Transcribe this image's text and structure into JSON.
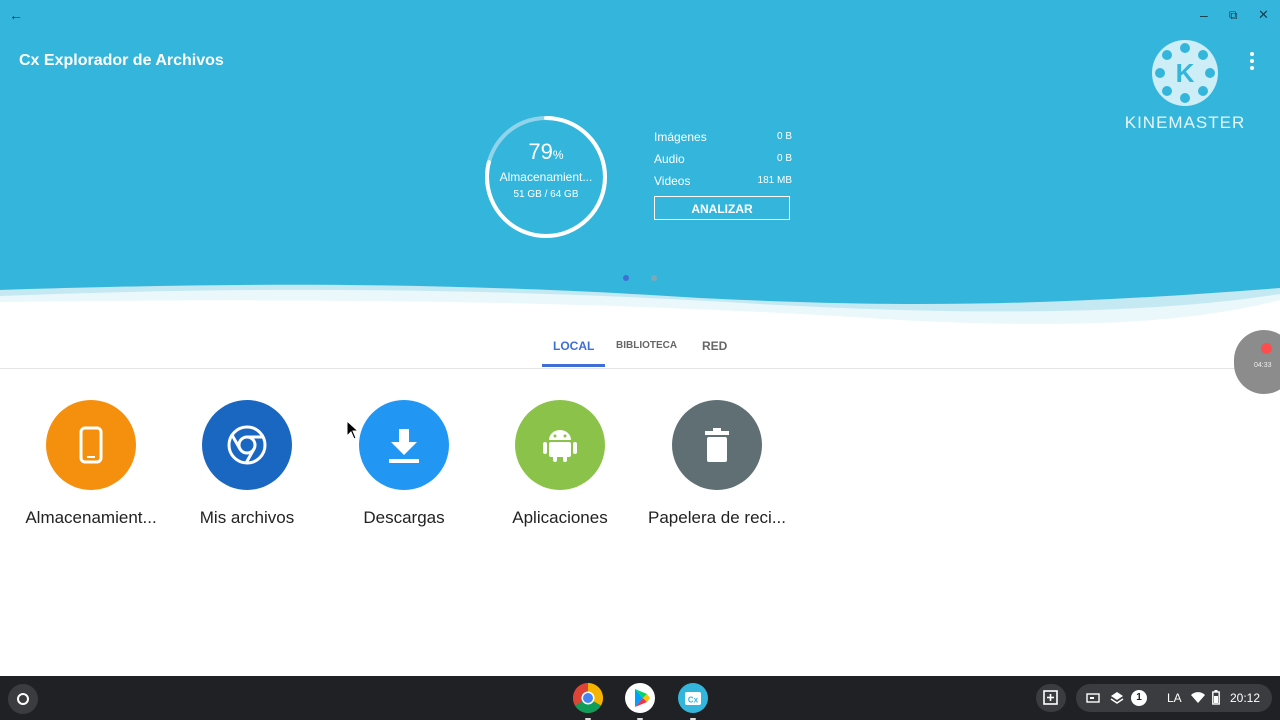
{
  "window": {
    "back_icon": "arrow-left-icon",
    "minimize": "–",
    "restore": "⧉",
    "close": "✕"
  },
  "app": {
    "title": "Cx Explorador de Archivos"
  },
  "storage_summary": {
    "percent": "79",
    "percent_sign": "%",
    "label": "Almacenamient...",
    "used_of_total": "51 GB / 64 GB",
    "fill_fraction": 0.79,
    "stats": [
      {
        "key": "Imágenes",
        "value": "0 B"
      },
      {
        "key": "Audio",
        "value": "0 B"
      },
      {
        "key": "Videos",
        "value": "181 MB"
      }
    ],
    "analyze_label": "ANALIZAR",
    "page_dots": {
      "count": 2,
      "active": 0
    }
  },
  "watermark": {
    "text": "KINEMASTER",
    "logo_letter": "K"
  },
  "tabs": [
    {
      "label": "LOCAL",
      "active": true
    },
    {
      "label": "BIBLIOTECA",
      "active": false
    },
    {
      "label": "RED",
      "active": false
    }
  ],
  "recording": {
    "time": "04:33"
  },
  "items": [
    {
      "label": "Almacenamient...",
      "icon": "tablet-icon",
      "color": "#f5900f"
    },
    {
      "label": "Mis archivos",
      "icon": "chrome-icon",
      "color": "#1a67c2"
    },
    {
      "label": "Descargas",
      "icon": "download-icon",
      "color": "#2196f3"
    },
    {
      "label": "Aplicaciones",
      "icon": "android-icon",
      "color": "#8bc34a"
    },
    {
      "label": "Papelera de reci...",
      "icon": "trash-icon",
      "color": "#5f6f74"
    }
  ],
  "shelf": {
    "apps": [
      "chrome-icon",
      "play-store-icon",
      "file-explorer-icon"
    ],
    "status": {
      "notification_count": "1",
      "ime": "LA",
      "time": "20:12"
    }
  },
  "colors": {
    "header": "#34b6dc",
    "accent": "#3f6fd6",
    "shelf": "#202124"
  }
}
